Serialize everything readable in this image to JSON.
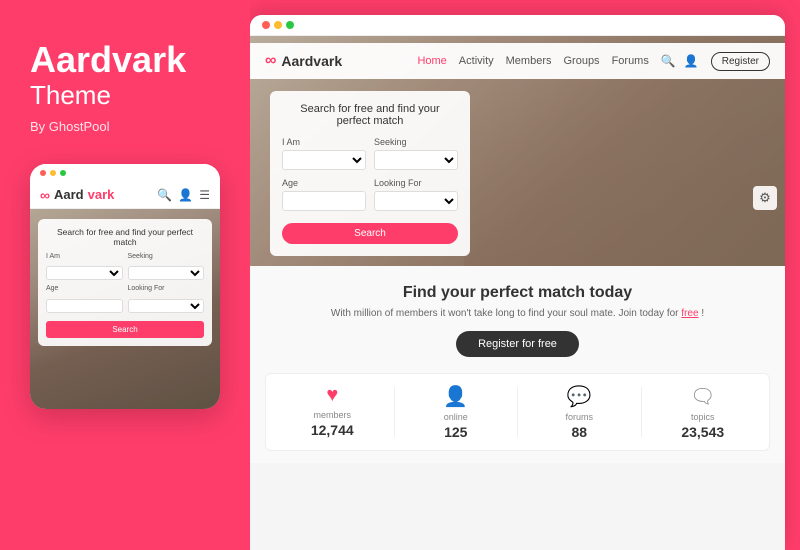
{
  "brand": {
    "title": "Aardvark",
    "subtitle": "Theme",
    "by": "By GhostPool"
  },
  "mobile": {
    "logo_text": "Aardvark",
    "logo_text_pink": "vark",
    "logo_text_dark": "Aard",
    "search_title": "Search for free and find your perfect match",
    "fields": {
      "i_am_label": "I Am",
      "seeking_label": "Seeking",
      "age_label": "Age",
      "looking_for_label": "Looking For"
    },
    "search_btn": "Search"
  },
  "desktop": {
    "logo": "Aardvark",
    "nav": {
      "home": "Home",
      "activity": "Activity",
      "members": "Members",
      "groups": "Groups",
      "forums": "Forums",
      "register_btn": "Register"
    },
    "hero": {
      "search_title": "Search for free and find your perfect match",
      "i_am_label": "I Am",
      "seeking_label": "Seeking",
      "age_label": "Age",
      "looking_for_label": "Looking For",
      "search_btn": "Search"
    },
    "stats_section": {
      "headline": "Find your perfect match today",
      "subtext": "With million of members it won't take long to find your soul mate. Join today for",
      "subtext_link": "free",
      "subtext_end": "!",
      "register_btn": "Register for free"
    },
    "stats": [
      {
        "icon": "heart",
        "label": "members",
        "value": "12,744"
      },
      {
        "icon": "person",
        "label": "online",
        "value": "125"
      },
      {
        "icon": "chat",
        "label": "forums",
        "value": "88"
      },
      {
        "icon": "bubble",
        "label": "topics",
        "value": "23,543"
      }
    ]
  },
  "colors": {
    "primary": "#ff3d6b",
    "dark": "#333333",
    "light": "#f9f9f9"
  }
}
